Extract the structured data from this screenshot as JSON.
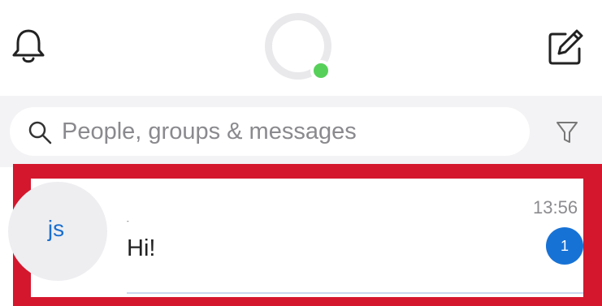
{
  "header": {
    "notifications_icon": "bell-icon",
    "compose_icon": "compose-icon",
    "profile": {
      "presence_status": "online",
      "presence_color": "#57d05a"
    }
  },
  "search": {
    "placeholder": "People, groups & messages",
    "search_icon": "search-icon",
    "filter_icon": "filter-icon"
  },
  "conversations": [
    {
      "initials": "js",
      "title": "-",
      "preview": "Hi!",
      "time": "13:56",
      "unread_count": "1",
      "selected": true
    }
  ],
  "colors": {
    "accent": "#1772d6",
    "highlight": "#d4172d",
    "initials": "#1a6fcf"
  }
}
